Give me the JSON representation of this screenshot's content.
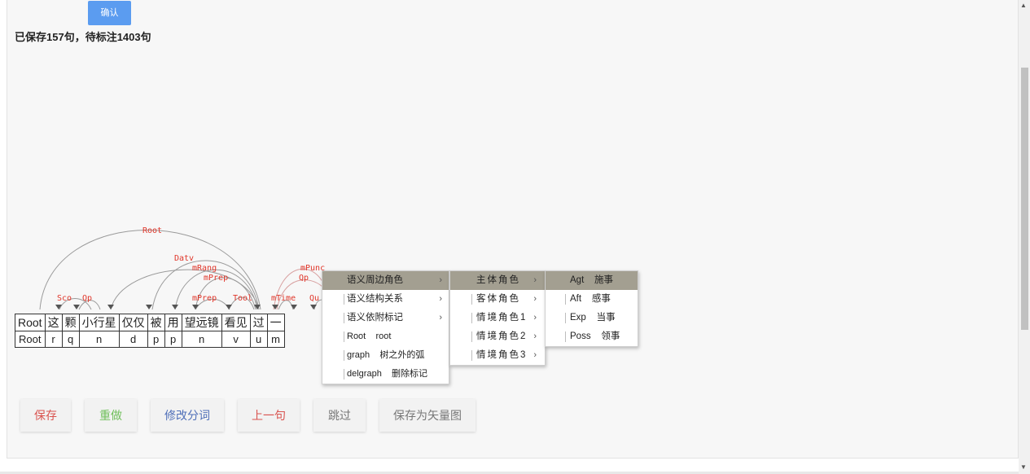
{
  "confirm_label": "确认",
  "status": "已保存157句，待标注1403句",
  "tokens": {
    "words": [
      "Root",
      "这",
      "颗",
      "小行星",
      "仅仅",
      "被",
      "用",
      "望远镜",
      "看见",
      "过",
      "一"
    ],
    "pos": [
      "Root",
      "r",
      "q",
      "n",
      "d",
      "p",
      "p",
      "n",
      "v",
      "u",
      "m"
    ]
  },
  "arc_labels": {
    "root": "Root",
    "sco": "Sco",
    "qp1": "Qp",
    "datv": "Datv",
    "mrang": "mRang",
    "mprep1": "mPrep",
    "mprep2": "mPrep",
    "tool": "Tool",
    "mpunc": "mPunc",
    "qp2": "Qp",
    "mtime": "mTime",
    "qu": "Qu"
  },
  "menu1": [
    {
      "label": "语义周边角色",
      "arrow": "›"
    },
    {
      "label": "语义结构关系",
      "arrow": "›"
    },
    {
      "label": "语义依附标记",
      "arrow": "›"
    },
    {
      "label": "Root    root",
      "arrow": ""
    },
    {
      "label": "graph    树之外的弧",
      "arrow": ""
    },
    {
      "label": "delgraph    删除标记",
      "arrow": ""
    }
  ],
  "menu2": [
    {
      "label": "主体角色",
      "arrow": "›"
    },
    {
      "label": "客体角色",
      "arrow": "›"
    },
    {
      "label": "情境角色1",
      "arrow": "›"
    },
    {
      "label": "情境角色2",
      "arrow": "›"
    },
    {
      "label": "情境角色3",
      "arrow": "›"
    }
  ],
  "menu3": [
    {
      "label": "Agt    施事"
    },
    {
      "label": "Aft    感事"
    },
    {
      "label": "Exp    当事"
    },
    {
      "label": "Poss    领事"
    }
  ],
  "buttons": {
    "save": "保存",
    "redo": "重做",
    "edit_seg": "修改分词",
    "prev": "上一句",
    "skip": "跳过",
    "save_svg": "保存为矢量图"
  },
  "colors": {
    "save": "#d9534f",
    "redo": "#6fbf5a",
    "edit_seg": "#4f6fb8",
    "prev": "#d9534f",
    "skip": "#777777",
    "save_svg": "#777777",
    "arc_label": "#e0362a",
    "confirm_bg": "#5b9cf0"
  }
}
